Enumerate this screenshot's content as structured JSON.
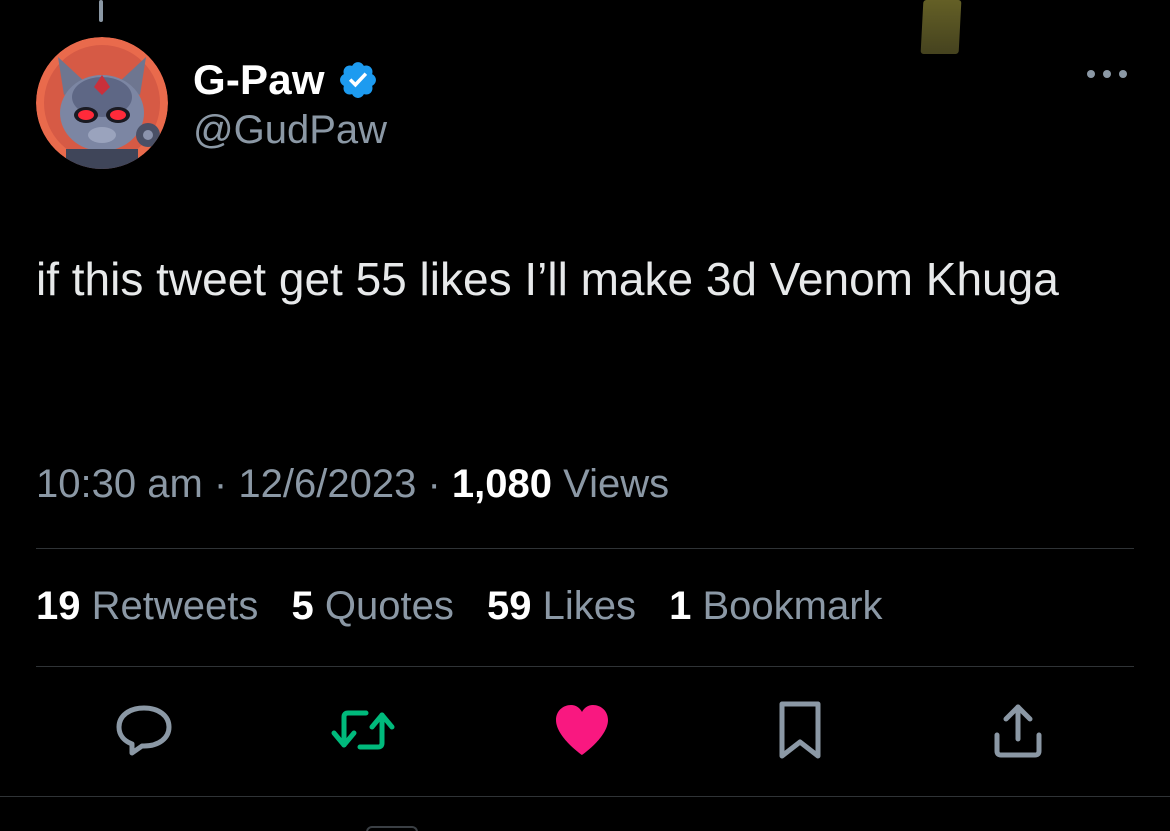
{
  "author": {
    "display_name": "G-Paw",
    "handle": "@GudPaw",
    "verified": true,
    "verified_color": "#1d9bf0"
  },
  "tweet": {
    "text": "if this tweet get 55 likes I’ll make 3d Venom Khuga"
  },
  "meta": {
    "time": "10:30 am",
    "date": "12/6/2023",
    "separator": "·",
    "views_count": "1,080",
    "views_label": "Views"
  },
  "stats": [
    {
      "count": "19",
      "label": "Retweets"
    },
    {
      "count": "5",
      "label": "Quotes"
    },
    {
      "count": "59",
      "label": "Likes"
    },
    {
      "count": "1",
      "label": "Bookmark"
    }
  ],
  "actions": [
    {
      "icon": "reply-icon",
      "color": "#8b98a5"
    },
    {
      "icon": "retweet-icon",
      "color": "#00ba7c"
    },
    {
      "icon": "like-icon",
      "color": "#f91880"
    },
    {
      "icon": "bookmark-icon",
      "color": "#8b98a5"
    },
    {
      "icon": "share-icon",
      "color": "#8b98a5"
    }
  ],
  "colors": {
    "background": "#000000",
    "text_primary": "#e7e9ea",
    "text_secondary": "#8b98a5",
    "divider": "#2f3336"
  }
}
